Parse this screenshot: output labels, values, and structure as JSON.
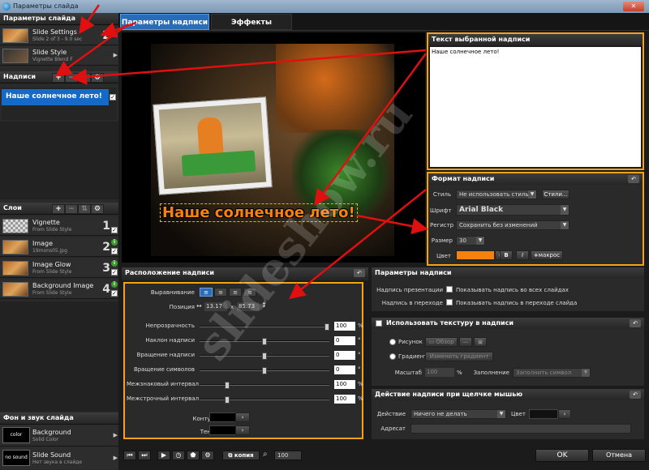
{
  "window": {
    "title": "Параметры слайда",
    "close_glyph": "✕"
  },
  "left": {
    "slide_params_header": "Параметры слайда",
    "slide_items": [
      {
        "title": "Slide Settings",
        "sub": "Slide 2 of 3 - 9.0 sec",
        "num": "2"
      },
      {
        "title": "Slide Style",
        "sub": "Vignette Blend F"
      }
    ],
    "captions_header": "Надписи",
    "caption_items": [
      {
        "text": "Наше солнечное лето!"
      }
    ],
    "layers_header": "Слои",
    "layers": [
      {
        "title": "Vignette",
        "sub": "From Slide Style",
        "num": "1"
      },
      {
        "title": "Image",
        "sub": "19mons05.jpg",
        "num": "2"
      },
      {
        "title": "Image Glow",
        "sub": "From Slide Style",
        "num": "3"
      },
      {
        "title": "Background Image",
        "sub": "From Slide Style",
        "num": "4"
      }
    ],
    "bg_sound_header": "Фон и звук слайда",
    "bg_items": [
      {
        "thumb": "color",
        "title": "Background",
        "sub": "Solid Color"
      },
      {
        "thumb": "no sound",
        "title": "Slide Sound",
        "sub": "Нет звука в слайде"
      }
    ]
  },
  "tabs": [
    {
      "label": "Параметры надписи"
    },
    {
      "label": "Эффекты"
    }
  ],
  "preview": {
    "caption": "Наше солнечное лето!"
  },
  "text_panel": {
    "title": "Текст выбранной надписи",
    "text": "Наше солнечное лето!"
  },
  "format_panel": {
    "title": "Формат надписи",
    "style_label": "Стиль",
    "style_value": "Не использовать стиль",
    "styles_button": "Стили...",
    "font_label": "Шрифт",
    "font_value": "Arial Black",
    "case_label": "Регистр",
    "case_value": "Сохранить без изменений",
    "size_label": "Размер",
    "size_value": "30",
    "color_label": "Цвет",
    "color_swatch": "#f5820f",
    "bold": "B",
    "italic": "I",
    "macro_button": "макрос"
  },
  "position_panel": {
    "title": "Расположение надписи",
    "align_label": "Выравнивание",
    "pos_label": "Позиция",
    "pos_x": "13.17",
    "pos_sep": "x",
    "pos_y": "85.73",
    "rows": [
      {
        "label": "Непрозрачность",
        "value": "100",
        "unit": "%",
        "knob": 1.0
      },
      {
        "label": "Наклон надписи",
        "value": "0",
        "unit": "°",
        "knob": 0.5
      },
      {
        "label": "Вращение надписи",
        "value": "0",
        "unit": "°",
        "knob": 0.5
      },
      {
        "label": "Вращение символов",
        "value": "0",
        "unit": "°",
        "knob": 0.5
      },
      {
        "label": "Межзнаковый интервал",
        "value": "100",
        "unit": "%",
        "knob": 0.2
      },
      {
        "label": "Межстрочный интервал",
        "value": "100",
        "unit": "%",
        "knob": 0.2
      }
    ],
    "outline_label": "Контур",
    "shadow_label": "Тень"
  },
  "caption_params": {
    "title": "Параметры надписи",
    "presentation_label": "Надпись презентации",
    "presentation_check": "Показывать надпись во всех слайдах",
    "transition_label": "Надпись в переходе",
    "transition_check": "Показывать надпись в переходе слайда"
  },
  "texture_panel": {
    "title": "Использовать текстуру в надписи",
    "picture_label": "Рисунок",
    "browse_button": "Обзор",
    "gradient_label": "Градиент",
    "gradient_button": "Изменить градиент",
    "scale_label": "Масштаб",
    "scale_value": "100",
    "scale_unit": "%",
    "fill_label": "Заполнение",
    "fill_value": "Заполнить символ"
  },
  "action_panel": {
    "title": "Действие надписи при щелчке мышью",
    "action_label": "Действие",
    "action_value": "Ничего не делать",
    "color_label": "Цвет",
    "address_label": "Адресат"
  },
  "bottom": {
    "copy_button": "копия",
    "zoom_value": "100",
    "ok": "OK",
    "cancel": "Отмена"
  },
  "watermark": "slideshow.ru"
}
